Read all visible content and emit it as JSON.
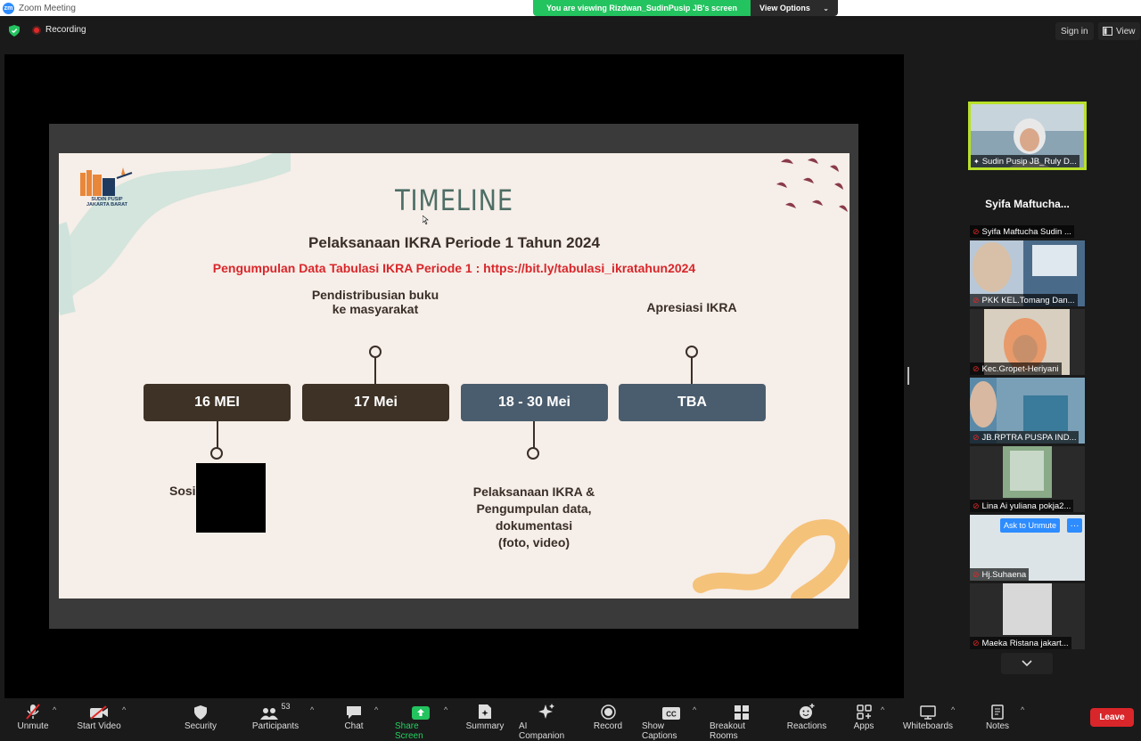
{
  "window": {
    "title": "Zoom Meeting",
    "app_logo": "zm"
  },
  "banner": {
    "viewing_text": "You are viewing Rizdwan_SudinPusip JB's screen",
    "view_options": "View Options"
  },
  "header": {
    "recording": "Recording",
    "sign_in": "Sign in",
    "view": "View"
  },
  "slide": {
    "org_name": "SUDIN PUSIP JAKARTA BARAT",
    "title": "TIMELINE",
    "subtitle": "Pelaksanaan IKRA Periode 1 Tahun 2024",
    "link_text": "Pengumpulan Data Tabulasi IKRA Periode 1 : https://bit.ly/tabulasi_ikratahun2024",
    "milestones": [
      {
        "date": "16 MEI",
        "label": "Sosia"
      },
      {
        "date": "17 Mei",
        "label_line1": "Pendistribusian buku",
        "label_line2": "ke masyarakat"
      },
      {
        "date": "18 - 30 Mei",
        "label_line1": "Pelaksanaan IKRA &",
        "label_line2": "Pengumpulan data,",
        "label_line3": "dokumentasi",
        "label_line4": "(foto, video)"
      },
      {
        "date": "TBA",
        "label": "Apresiasi IKRA"
      }
    ],
    "colors": {
      "dark": "#3e3226",
      "slate": "#4a5d6e",
      "red": "#d9262a",
      "title": "#4d6e66"
    }
  },
  "gallery": {
    "tiles": [
      {
        "name": "Sudin Pusip JB_Ruly D..."
      },
      {
        "heading": "Syifa  Maftucha...",
        "name": "Syifa Maftucha Sudin ..."
      },
      {
        "name": "PKK KEL.Tomang Dan..."
      },
      {
        "name": "Kec.Gropet-Heriyani"
      },
      {
        "name": "JB.RPTRA PUSPA IND..."
      },
      {
        "name": "Lina Ai yuliana pokja2..."
      },
      {
        "name": "Hj.Suhaena",
        "ask_unmute": "Ask to Unmute",
        "more": "···"
      },
      {
        "name": "Maeka Ristana jakart..."
      }
    ]
  },
  "toolbar": {
    "unmute": "Unmute",
    "start_video": "Start Video",
    "security": "Security",
    "participants": "Participants",
    "participants_count": "53",
    "chat": "Chat",
    "share_screen": "Share Screen",
    "summary": "Summary",
    "ai_companion": "AI Companion",
    "record": "Record",
    "show_captions": "Show Captions",
    "breakout_rooms": "Breakout Rooms",
    "reactions": "Reactions",
    "apps": "Apps",
    "whiteboards": "Whiteboards",
    "notes": "Notes",
    "leave": "Leave"
  }
}
